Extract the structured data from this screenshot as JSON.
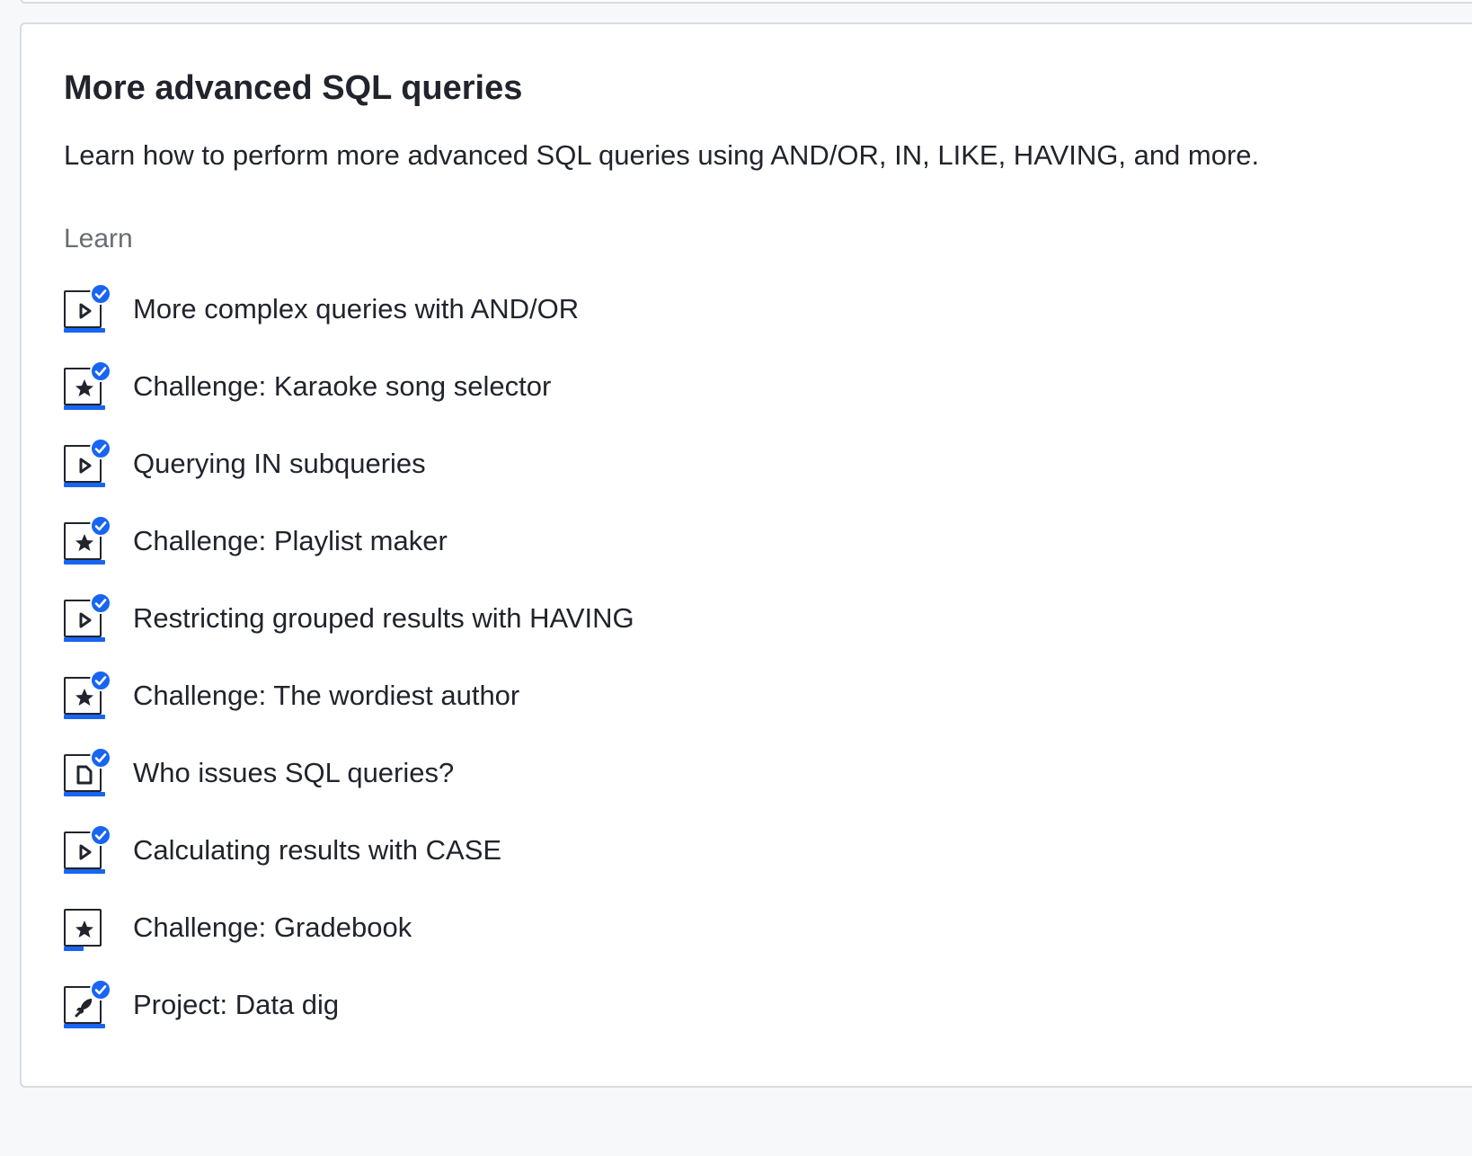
{
  "unit": {
    "title": "More advanced SQL queries",
    "description": "Learn how to perform more advanced SQL queries using AND/OR, IN, LIKE, HAVING, and more.",
    "section_label": "Learn"
  },
  "items": [
    {
      "label": "More complex queries with AND/OR",
      "icon": "video-icon",
      "completed": true
    },
    {
      "label": "Challenge: Karaoke song selector",
      "icon": "star-icon",
      "completed": true
    },
    {
      "label": "Querying IN subqueries",
      "icon": "video-icon",
      "completed": true
    },
    {
      "label": "Challenge: Playlist maker",
      "icon": "star-icon",
      "completed": true
    },
    {
      "label": "Restricting grouped results with HAVING",
      "icon": "video-icon",
      "completed": true
    },
    {
      "label": "Challenge: The wordiest author",
      "icon": "star-icon",
      "completed": true
    },
    {
      "label": "Who issues SQL queries?",
      "icon": "article-icon",
      "completed": true
    },
    {
      "label": "Calculating results with CASE",
      "icon": "video-icon",
      "completed": true
    },
    {
      "label": "Challenge: Gradebook",
      "icon": "star-icon",
      "completed": false
    },
    {
      "label": "Project: Data dig",
      "icon": "rocket-icon",
      "completed": true
    }
  ],
  "colors": {
    "accent": "#1865f2",
    "text": "#21242c",
    "muted": "#6b6d73",
    "border": "#dadce0"
  }
}
